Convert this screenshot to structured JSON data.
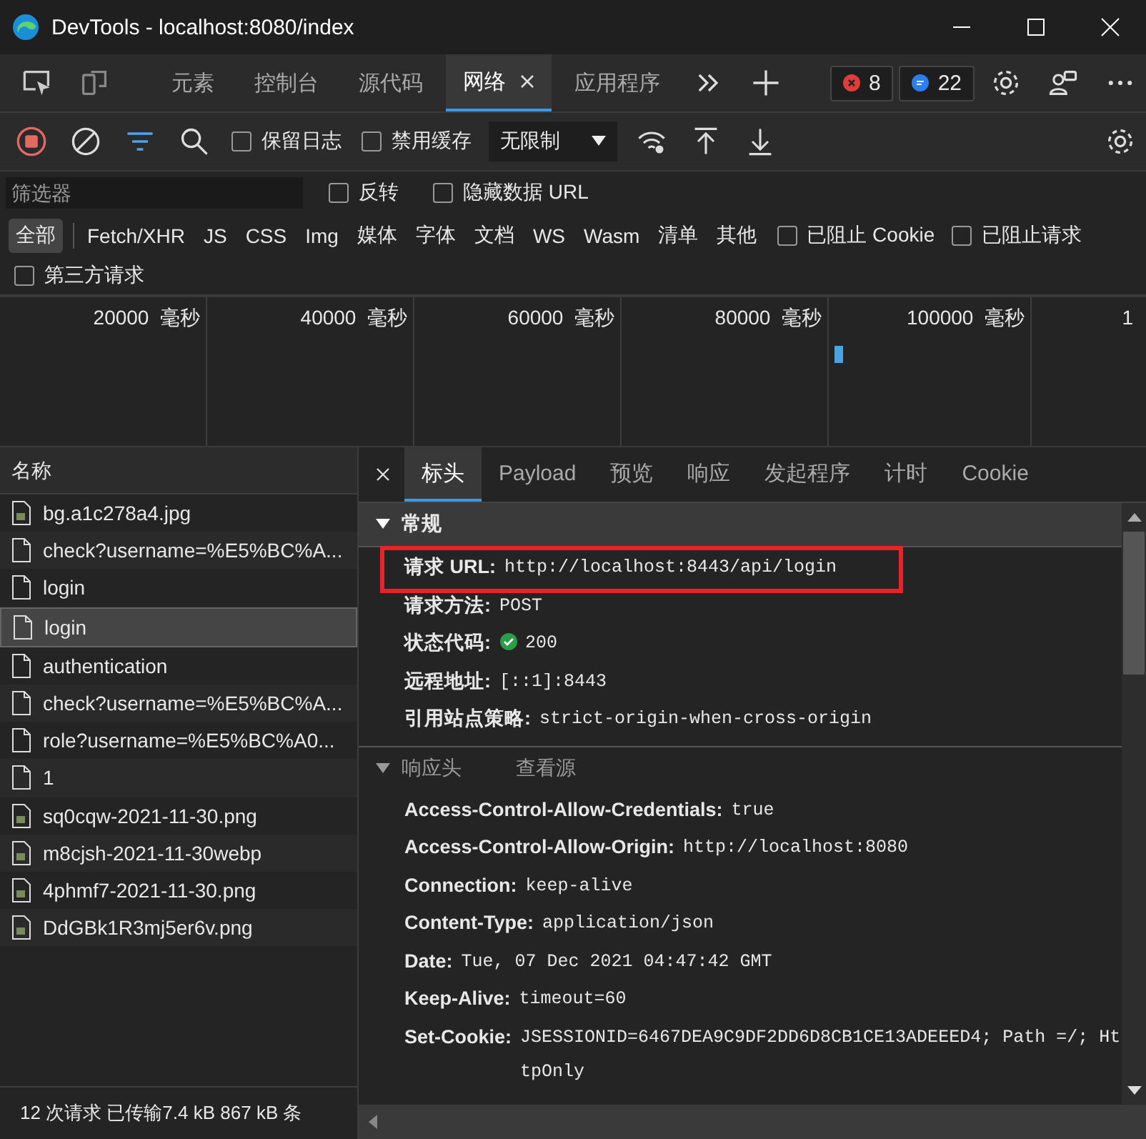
{
  "window": {
    "title": "DevTools - localhost:8080/index"
  },
  "tabs": [
    {
      "label": "元素",
      "selected": false,
      "closable": false
    },
    {
      "label": "控制台",
      "selected": false,
      "closable": false
    },
    {
      "label": "源代码",
      "selected": false,
      "closable": false
    },
    {
      "label": "网络",
      "selected": true,
      "closable": true
    },
    {
      "label": "应用程序",
      "selected": false,
      "closable": false
    }
  ],
  "badges": {
    "errors": "8",
    "messages": "22"
  },
  "toolbar": {
    "options": [
      {
        "label": "保留日志",
        "checked": false
      },
      {
        "label": "禁用缓存",
        "checked": false
      }
    ],
    "throttling": "无限制"
  },
  "filter": {
    "placeholder": "筛选器",
    "options": [
      {
        "label": "反转",
        "checked": false
      },
      {
        "label": "隐藏数据 URL",
        "checked": false
      }
    ]
  },
  "types": [
    {
      "label": "全部",
      "selected": true
    },
    {
      "label": "Fetch/XHR",
      "selected": false
    },
    {
      "label": "JS",
      "selected": false
    },
    {
      "label": "CSS",
      "selected": false
    },
    {
      "label": "Img",
      "selected": false
    },
    {
      "label": "媒体",
      "selected": false
    },
    {
      "label": "字体",
      "selected": false
    },
    {
      "label": "文档",
      "selected": false
    },
    {
      "label": "WS",
      "selected": false
    },
    {
      "label": "Wasm",
      "selected": false
    },
    {
      "label": "清单",
      "selected": false
    },
    {
      "label": "其他",
      "selected": false
    }
  ],
  "type_options": [
    {
      "label": "已阻止 Cookie",
      "checked": false
    },
    {
      "label": "已阻止请求",
      "checked": false
    },
    {
      "label": "第三方请求",
      "checked": false
    }
  ],
  "timeline": {
    "ticks": [
      "20000  毫秒",
      "40000  毫秒",
      "60000  毫秒",
      "80000  毫秒",
      "100000  毫秒",
      "1"
    ]
  },
  "requests": {
    "header": "名称",
    "rows": [
      {
        "name": "bg.a1c278a4.jpg",
        "kind": "image",
        "selected": false
      },
      {
        "name": "check?username=%E5%BC%A...",
        "kind": "document",
        "selected": false
      },
      {
        "name": "login",
        "kind": "document",
        "selected": false
      },
      {
        "name": "login",
        "kind": "document",
        "selected": true
      },
      {
        "name": "authentication",
        "kind": "document",
        "selected": false
      },
      {
        "name": "check?username=%E5%BC%A...",
        "kind": "document",
        "selected": false
      },
      {
        "name": "role?username=%E5%BC%A0...",
        "kind": "document",
        "selected": false
      },
      {
        "name": "1",
        "kind": "document",
        "selected": false
      },
      {
        "name": "sq0cqw-2021-11-30.png",
        "kind": "image",
        "selected": false
      },
      {
        "name": "m8cjsh-2021-11-30webp",
        "kind": "image",
        "selected": false
      },
      {
        "name": "4phmf7-2021-11-30.png",
        "kind": "image",
        "selected": false
      },
      {
        "name": "DdGBk1R3mj5er6v.png",
        "kind": "image",
        "selected": false
      }
    ],
    "status": "12 次请求  已传输7.4 kB  867 kB 条"
  },
  "detail_tabs": [
    {
      "label": "标头",
      "selected": true
    },
    {
      "label": "Payload",
      "selected": false
    },
    {
      "label": "预览",
      "selected": false
    },
    {
      "label": "响应",
      "selected": false
    },
    {
      "label": "发起程序",
      "selected": false
    },
    {
      "label": "计时",
      "selected": false
    },
    {
      "label": "Cookie",
      "selected": false
    }
  ],
  "general": {
    "title": "常规",
    "expanded": true,
    "rows": [
      {
        "key": "请求 URL:",
        "value": "http://localhost:8443/api/login",
        "highlighted": true,
        "status_ok": false
      },
      {
        "key": "请求方法:",
        "value": "POST",
        "highlighted": false,
        "status_ok": false
      },
      {
        "key": "状态代码:",
        "value": "200",
        "highlighted": false,
        "status_ok": true
      },
      {
        "key": "远程地址:",
        "value": "[::1]:8443",
        "highlighted": false,
        "status_ok": false
      },
      {
        "key": "引用站点策略:",
        "value": "strict-origin-when-cross-origin",
        "highlighted": false,
        "status_ok": false
      }
    ]
  },
  "response_headers": {
    "title": "响应头",
    "expanded": true,
    "view_source": "查看源",
    "rows": [
      {
        "key": "Access-Control-Allow-Credentials:",
        "value": "true"
      },
      {
        "key": "Access-Control-Allow-Origin:",
        "value": "http://localhost:8080"
      },
      {
        "key": "Connection:",
        "value": "keep-alive"
      },
      {
        "key": "Content-Type:",
        "value": "application/json"
      },
      {
        "key": "Date:",
        "value": "Tue, 07 Dec 2021 04:47:42 GMT"
      },
      {
        "key": "Keep-Alive:",
        "value": "timeout=60"
      },
      {
        "key": "Set-Cookie:",
        "value": "JSESSIONID=6467DEA9C9DF2DD6D8CB1CE13ADEEED4; Path =/; HttpOnly"
      }
    ]
  }
}
